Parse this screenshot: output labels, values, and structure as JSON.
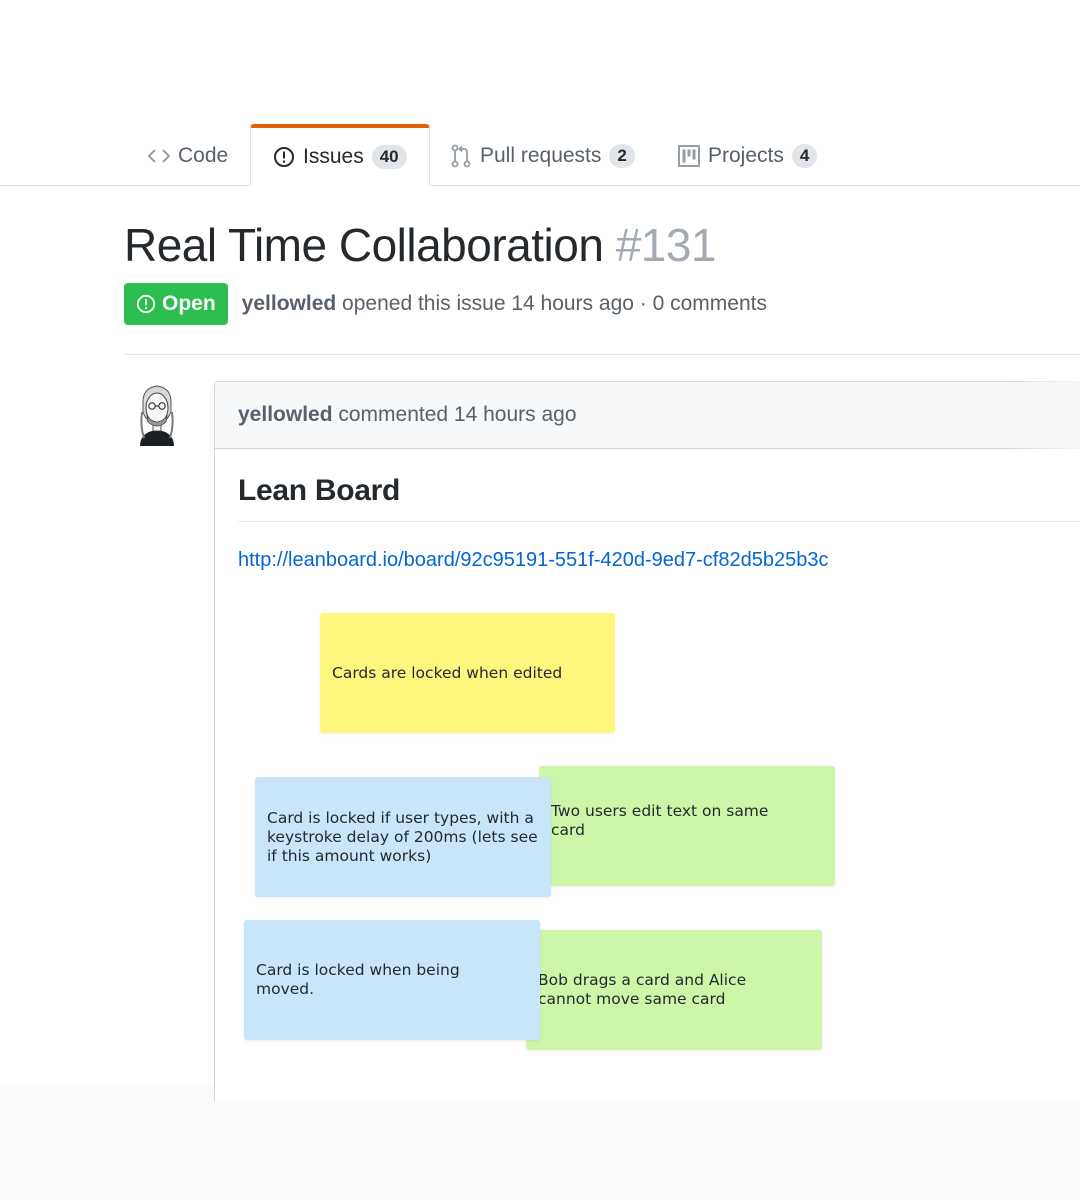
{
  "tabs": [
    {
      "label": "Code",
      "icon": "code-icon"
    },
    {
      "label": "Issues",
      "icon": "issue-opened-icon",
      "count": "40",
      "selected": true
    },
    {
      "label": "Pull requests",
      "icon": "git-pull-request-icon",
      "count": "2"
    },
    {
      "label": "Projects",
      "icon": "project-icon",
      "count": "4"
    }
  ],
  "issue": {
    "title": "Real Time Collaboration",
    "number": "#131",
    "state": "Open",
    "author": "yellowled",
    "opened_text": "opened this issue 14 hours ago · 0 comments"
  },
  "comment": {
    "author": "yellowled",
    "timestamp_text": "commented 14 hours ago",
    "heading": "Lean Board",
    "link": "http://leanboard.io/board/92c95191-551f-420d-9ed7-cf82d5b25b3c"
  },
  "cards": [
    {
      "text": "Cards are locked when edited",
      "color": "#fdf77e"
    },
    {
      "text": "Two users edit text on same card",
      "color": "#cef6a9"
    },
    {
      "text": "Card is locked if user types, with a keystroke delay of 200ms (lets see if this amount works)",
      "color": "#c9e5f9"
    },
    {
      "text": "Bob drags a card and Alice cannot move same card",
      "color": "#cef6a9"
    },
    {
      "text": "Card is locked when being moved.",
      "color": "#c9e5f9"
    }
  ],
  "colors": {
    "accent_tab": "#e36209",
    "open_green": "#2cbe4e",
    "link_blue": "#0366d6"
  }
}
